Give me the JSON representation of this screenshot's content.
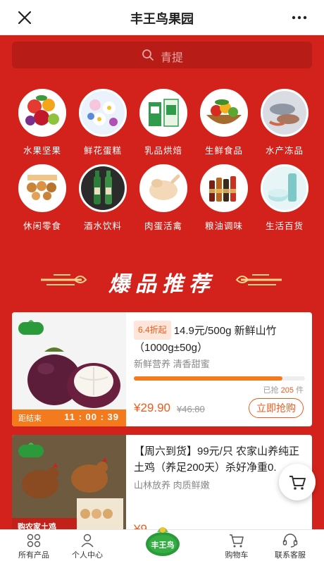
{
  "header": {
    "title": "丰王鸟果园",
    "close_icon": "close-icon",
    "more_icon": "more-dots-icon"
  },
  "search": {
    "placeholder": "青提",
    "icon": "search-icon"
  },
  "categories": [
    {
      "label": "水果坚果",
      "icon": "fruit-nuts-image"
    },
    {
      "label": "鲜花蛋糕",
      "icon": "flowers-cake-image"
    },
    {
      "label": "乳品烘焙",
      "icon": "dairy-bakery-image"
    },
    {
      "label": "生鲜食品",
      "icon": "fresh-produce-image"
    },
    {
      "label": "水产冻品",
      "icon": "seafood-frozen-image"
    },
    {
      "label": "休闲零食",
      "icon": "snacks-image"
    },
    {
      "label": "酒水饮料",
      "icon": "drinks-image"
    },
    {
      "label": "肉蛋活禽",
      "icon": "meat-eggs-image"
    },
    {
      "label": "粮油调味",
      "icon": "grain-oil-image"
    },
    {
      "label": "生活百货",
      "icon": "daily-goods-image"
    }
  ],
  "section": {
    "title": "爆品推荐"
  },
  "products": [
    {
      "tag": "6.4折起",
      "title": "14.9元/500g 新鲜山竹（1000g±50g）",
      "subtitle": "新鲜营养 清香甜蜜",
      "sold_prefix": "已抢",
      "sold_count": "205",
      "sold_suffix": "件",
      "progress": 0.87,
      "price": "¥29.90",
      "original_price": "¥46.80",
      "buy_label": "立即抢购",
      "countdown_label": "距结束",
      "countdown": "11 : 00 : 39",
      "brand_badge": "丰王鸟"
    },
    {
      "title": "【周六到货】99元/只 农家山养纯正土鸡（养足200天）杀好净重0.",
      "subtitle": "山林放养 肉质鲜嫩",
      "price": "¥9",
      "image_caption": "购农家土鸡",
      "brand_badge": "丰王鸟"
    }
  ],
  "bottom_nav": [
    {
      "label": "所有产品",
      "icon": "grid-icon"
    },
    {
      "label": "个人中心",
      "icon": "user-icon"
    },
    {
      "label": "丰王鸟",
      "icon": "brand-logo"
    },
    {
      "label": "购物车",
      "icon": "cart-icon"
    },
    {
      "label": "联系客服",
      "icon": "headset-icon"
    }
  ],
  "colors": {
    "brand_red": "#d3221b",
    "accent_orange": "#f37b1d",
    "price_orange": "#f05a1c",
    "logo_green": "#2b9a3a"
  }
}
